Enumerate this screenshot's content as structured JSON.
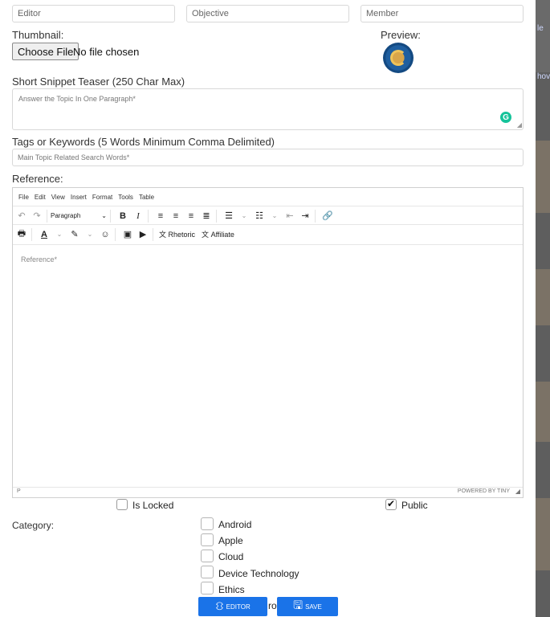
{
  "top_fields": {
    "editor": "Editor",
    "objective": "Objective",
    "member": "Member"
  },
  "thumbnail": {
    "label": "Thumbnail:",
    "button": "Choose File",
    "status": "No file chosen",
    "preview_label": "Preview:"
  },
  "snippet": {
    "label": "Short Snippet Teaser (250 Char Max)",
    "placeholder": "Answer the Topic In One Paragraph*",
    "grammarly": "G"
  },
  "tags": {
    "label": "Tags or Keywords (5 Words Minimum Comma Delimited)",
    "placeholder": "Main Topic Related Search Words*"
  },
  "reference": {
    "label": "Reference:",
    "menu": [
      "File",
      "Edit",
      "View",
      "Insert",
      "Format",
      "Tools",
      "Table"
    ],
    "format_select": "Paragraph",
    "rhetoric": "Rhetoric",
    "affiliate": "Affiliate",
    "placeholder": "Reference*",
    "status_path": "P",
    "powered": "POWERED BY TINY"
  },
  "flags": {
    "locked_label": "Is Locked",
    "locked_checked": false,
    "public_label": "Public",
    "public_checked": true
  },
  "category": {
    "label": "Category:",
    "items": [
      "Android",
      "Apple",
      "Cloud",
      "Device Technology",
      "Ethics"
    ],
    "partial": "ro"
  },
  "actions": {
    "editor": "EDITOR",
    "save": "SAVE"
  },
  "side_panel": {
    "text_top": "le",
    "text_mid": "hov"
  },
  "colors": {
    "primary": "#1a73e8",
    "grammarly": "#15c39a"
  }
}
